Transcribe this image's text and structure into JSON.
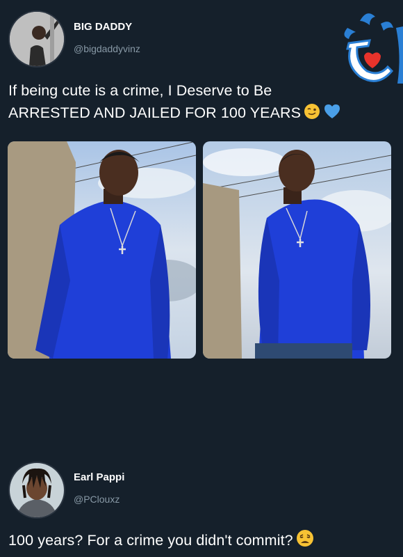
{
  "tweet1": {
    "display_name": "BIG DADDY",
    "handle": "@bigdaddyvinz",
    "text_line1": "If being cute is a crime, I Deserve to Be",
    "text_line2": "ARRESTED AND JAILED FOR 100 YEARS",
    "emojis": [
      "winking-face-icon",
      "blue-heart-icon"
    ],
    "photos": [
      "man-blue-turtleneck-photo-1",
      "man-blue-turtleneck-photo-2"
    ]
  },
  "tweet2": {
    "display_name": "Earl Pappi",
    "handle": "@PClouxz",
    "text": "100 years? For a crime you didn't commit?",
    "emojis": [
      "weary-face-icon"
    ]
  },
  "colors": {
    "background": "#15202b",
    "handle_gray": "#8899a6",
    "sweater_blue": "#1f3fd8",
    "logo_blue": "#2a7fd4"
  }
}
